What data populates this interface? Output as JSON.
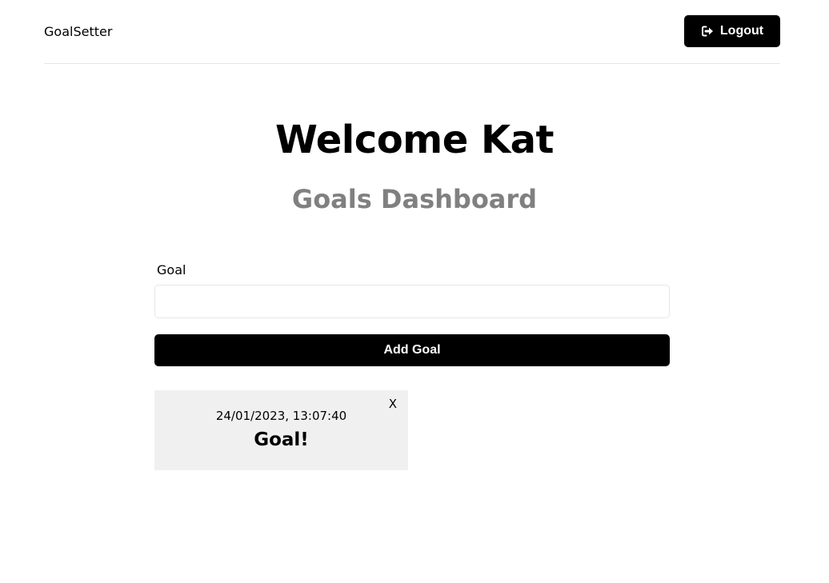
{
  "header": {
    "logo": "GoalSetter",
    "logout_label": "Logout",
    "logout_icon": "sign-out-icon"
  },
  "main": {
    "welcome": "Welcome Kat",
    "subtitle": "Goals Dashboard"
  },
  "form": {
    "goal_label": "Goal",
    "goal_value": "",
    "add_label": "Add Goal"
  },
  "goals": [
    {
      "date": "24/01/2023, 13:07:40",
      "text": "Goal!",
      "close_label": "X"
    }
  ]
}
